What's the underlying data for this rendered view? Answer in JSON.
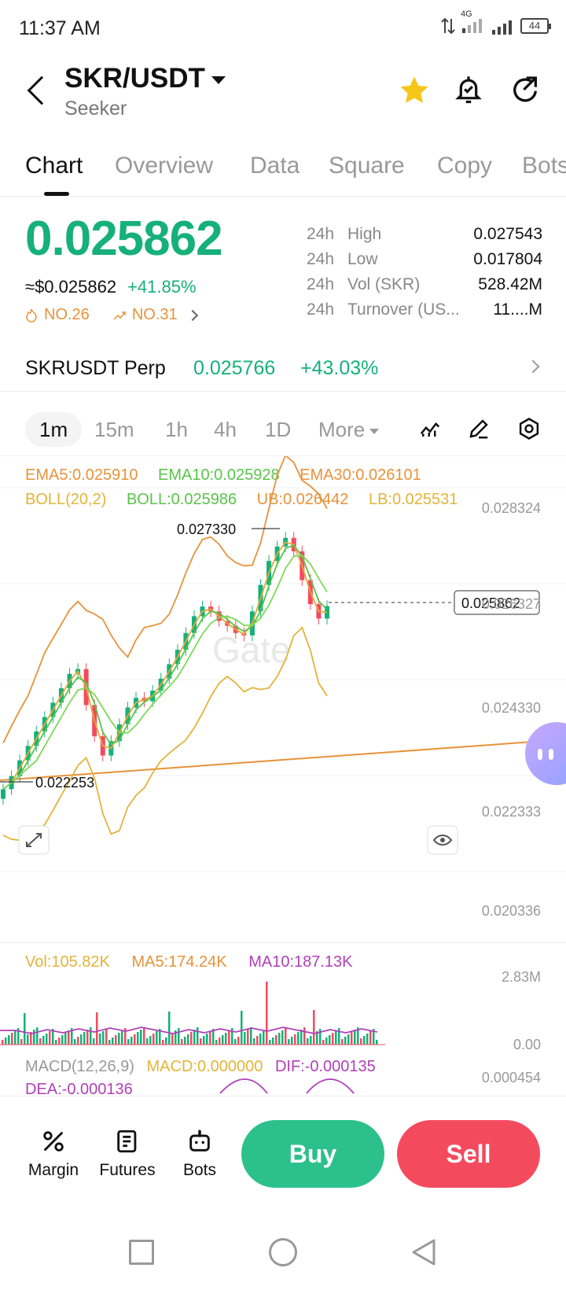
{
  "status_bar": {
    "time": "11:37 AM",
    "network": "4G",
    "battery": "44"
  },
  "header": {
    "pair": "SKR/USDT",
    "name": "Seeker"
  },
  "tabs": [
    {
      "label": "Chart",
      "active": true
    },
    {
      "label": "Overview"
    },
    {
      "label": "Data"
    },
    {
      "label": "Square"
    },
    {
      "label": "Copy"
    },
    {
      "label": "Bots"
    }
  ],
  "ticker": {
    "price": "0.025862",
    "usd_price": "≈$0.025862",
    "change": "+41.85%",
    "rank_hot": "NO.26",
    "rank_gain": "NO.31",
    "stats": [
      {
        "period": "24h",
        "label": "High",
        "value": "0.027543"
      },
      {
        "period": "24h",
        "label": "Low",
        "value": "0.017804"
      },
      {
        "period": "24h",
        "label": "Vol (SKR)",
        "value": "528.42M"
      },
      {
        "period": "24h",
        "label": "Turnover (US...",
        "value": "11....M"
      }
    ]
  },
  "perp": {
    "label": "SKRUSDT Perp",
    "price": "0.025766",
    "change": "+43.03%"
  },
  "intervals": {
    "items": [
      "1m",
      "15m",
      "1h",
      "4h",
      "1D"
    ],
    "more": "More"
  },
  "indicators": {
    "ema5": "EMA5:0.025910",
    "ema10": "EMA10:0.025928",
    "ema30": "EMA30:0.026101",
    "boll": "BOLL(20,2)",
    "boll_mid": "BOLL:0.025986",
    "ub": "UB:0.026442",
    "lb": "LB:0.025531"
  },
  "chart": {
    "y_ticks": [
      "0.028324",
      "0.026327",
      "0.024330",
      "0.022333",
      "0.020336"
    ],
    "high_label": "0.027330",
    "low_label": "0.022253",
    "current_label": "0.025862",
    "watermark": "Gate"
  },
  "volume": {
    "vol": "Vol:105.82K",
    "ma5": "MA5:174.24K",
    "ma10": "MA10:187.13K",
    "y_top": "2.83M",
    "y_bottom": "0.00"
  },
  "macd": {
    "label": "MACD(12,26,9)",
    "macd": "MACD:0.000000",
    "dif": "DIF:-0.000135",
    "dea": "DEA:-0.000136",
    "y_top": "0.000454"
  },
  "bottom_nav": {
    "margin": "Margin",
    "futures": "Futures",
    "bots": "Bots",
    "buy": "Buy",
    "sell": "Sell"
  },
  "colors": {
    "green": "#16b07a",
    "red": "#f44a5e",
    "orange": "#e8923a",
    "ema5": "#e3a93a",
    "ema10": "#58c44a",
    "purple": "#b03fb8"
  },
  "chart_data": {
    "type": "candlestick",
    "interval": "1m",
    "ylim": [
      0.020336,
      0.028324
    ],
    "close_series": [
      0.02205,
      0.02232,
      0.02265,
      0.02295,
      0.02325,
      0.02355,
      0.02385,
      0.02415,
      0.02445,
      0.02455,
      0.0238,
      0.02315,
      0.02275,
      0.02305,
      0.0234,
      0.02375,
      0.02395,
      0.02388,
      0.0241,
      0.02435,
      0.02465,
      0.02495,
      0.0253,
      0.02565,
      0.02585,
      0.02575,
      0.02555,
      0.02545,
      0.0253,
      0.02525,
      0.02575,
      0.0263,
      0.0268,
      0.0271,
      0.02728,
      0.027,
      0.0264,
      0.0259,
      0.0256,
      0.02586
    ],
    "high": 0.02733,
    "low": 0.022253,
    "last": 0.025862
  }
}
